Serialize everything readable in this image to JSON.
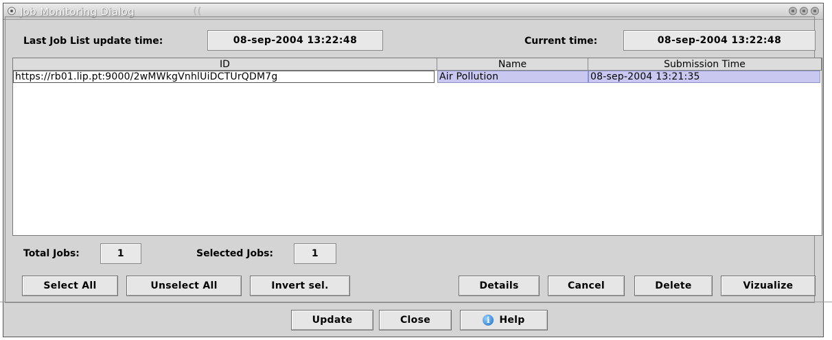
{
  "window": {
    "title": "Job Monitoring Dialog",
    "title_deco": "(("
  },
  "header": {
    "last_update_label": "Last Job List update time:",
    "last_update_value": "08-sep-2004 13:22:48",
    "current_time_label": "Current time:",
    "current_time_value": "08-sep-2004 13:22:48"
  },
  "table": {
    "columns": [
      "ID",
      "Name",
      "Submission Time"
    ],
    "rows": [
      {
        "id": "https://rb01.lip.pt:9000/2wMWkgVnhlUiDCTUrQDM7g",
        "name": "Air Pollution",
        "submission_time": "08-sep-2004 13:21:35"
      }
    ]
  },
  "stats": {
    "total_label": "Total Jobs:",
    "total_value": "1",
    "selected_label": "Selected Jobs:",
    "selected_value": "1"
  },
  "actions": {
    "select_all": "Select All",
    "unselect_all": "Unselect All",
    "invert_sel": "Invert sel.",
    "details": "Details",
    "cancel": "Cancel",
    "delete": "Delete",
    "vizualize": "Vizualize"
  },
  "footer": {
    "update": "Update",
    "close": "Close",
    "help": "Help"
  },
  "colors": {
    "selected_row": "#c8c8f0",
    "window_bg": "#d4d4d4"
  }
}
